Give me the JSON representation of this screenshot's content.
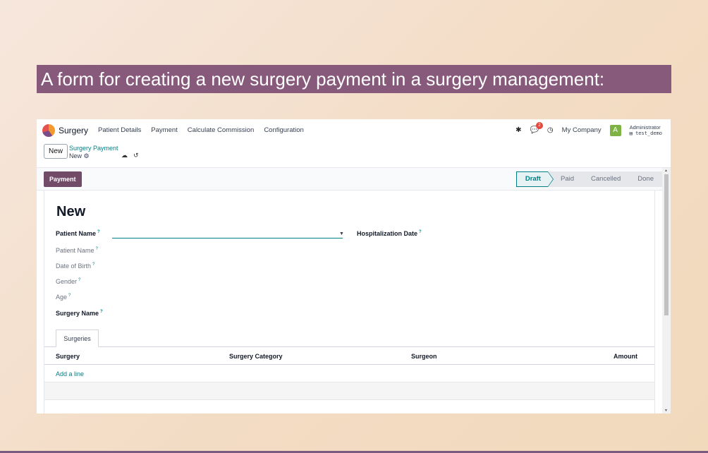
{
  "caption": "A form for creating a new surgery payment in a surgery management:",
  "navbar": {
    "app_name": "Surgery",
    "menu": [
      "Patient Details",
      "Payment",
      "Calculate Commission",
      "Configuration"
    ],
    "badge_count": "2",
    "company": "My Company",
    "avatar_letter": "A",
    "user_name": "Administrator",
    "user_db": "test_demo"
  },
  "control": {
    "new_label": "New",
    "breadcrumb_parent": "Surgery Payment",
    "breadcrumb_current": "New"
  },
  "status": {
    "payment_button": "Payment",
    "stages": [
      "Draft",
      "Paid",
      "Cancelled",
      "Done"
    ],
    "active_stage": "Draft"
  },
  "form": {
    "title": "New",
    "patient_name_label": "Patient Name",
    "hospitalization_date_label": "Hospitalization Date",
    "patient_name_readonly_label": "Patient Name",
    "dob_label": "Date of Birth",
    "gender_label": "Gender",
    "age_label": "Age",
    "surgery_name_label": "Surgery Name",
    "tooltip_mark": "?"
  },
  "tabs": [
    "Surgeries"
  ],
  "table": {
    "columns": [
      "Surgery",
      "Surgery Category",
      "Surgeon",
      "Amount"
    ],
    "add_line": "Add a line"
  },
  "colors": {
    "brand": "#714b67",
    "accent": "#017e84",
    "caption_bg": "#875a7b"
  }
}
